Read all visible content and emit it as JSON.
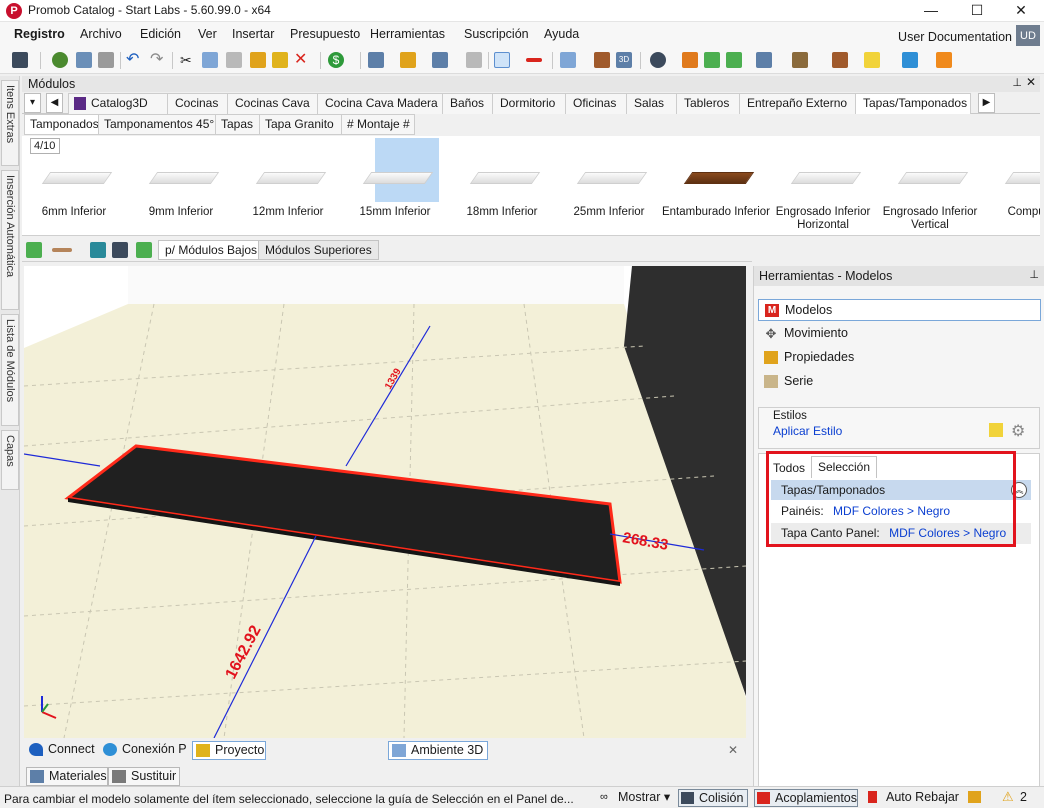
{
  "window": {
    "title": "Promob Catalog - Start Labs - 5.60.99.0 - x64",
    "controls": [
      "—",
      "☐",
      "✕"
    ]
  },
  "menu": {
    "items": [
      "Registro",
      "Archivo",
      "Edición",
      "Ver",
      "Insertar",
      "Presupuesto",
      "Herramientas",
      "Suscripción",
      "Ayuda"
    ],
    "user_documentation": "User Documentation",
    "user_initials": "UD"
  },
  "left_dock": {
    "tabs": [
      "Itens Extras",
      "Inserción Automática",
      "Lista de Módulos",
      "Capas"
    ]
  },
  "modulos": {
    "title": "Módulos",
    "pin": "ᵖ",
    "close": "✕",
    "category_tabs": [
      "Catalog3D",
      "Cocinas",
      "Cocinas Cava",
      "Cocina Cava Madera",
      "Baños",
      "Dormitorio",
      "Oficinas",
      "Salas",
      "Tableros",
      "Entrepaño Externo",
      "Tapas/Tamponados"
    ],
    "active_category": "Tapas/Tamponados",
    "sub_tabs": [
      "Tamponados",
      "Tamponamentos 45°",
      "Tapas",
      "Tapa Granito",
      "# Montaje #"
    ],
    "active_sub_tab": "Tamponados",
    "page_counter": "4/10",
    "items": [
      {
        "label": "6mm Inferior",
        "dark": false
      },
      {
        "label": "9mm Inferior",
        "dark": false
      },
      {
        "label": "12mm Inferior",
        "dark": false
      },
      {
        "label": "15mm Inferior",
        "dark": false,
        "selected": true
      },
      {
        "label": "18mm Inferior",
        "dark": false
      },
      {
        "label": "25mm Inferior",
        "dark": false
      },
      {
        "label": "Entamburado Inferior",
        "dark": true
      },
      {
        "label": "Engrosado Inferior Horizontal",
        "dark": false
      },
      {
        "label": "Engrosado Inferior Vertical",
        "dark": false
      },
      {
        "label": "Compuesto",
        "dark": false
      }
    ]
  },
  "view_tabs": {
    "items": [
      "p/ Módulos Bajos",
      "Módulos Superiores"
    ],
    "active": "p/ Módulos Bajos"
  },
  "viewport": {
    "dimension_top": "1339",
    "dimension_right": "268.33",
    "dimension_bottom": "1642.92"
  },
  "bottom_tabs": {
    "items": [
      "Connect",
      "Conexión P",
      "Proyecto"
    ],
    "active": "Proyecto",
    "view_tab": "Ambiente 3D",
    "close": "✕"
  },
  "lower_tabs": [
    "Materiales",
    "Sustituir"
  ],
  "right_panel": {
    "title": "Herramientas - Modelos",
    "pin": "ᵖ",
    "items": [
      "Modelos",
      "Movimiento",
      "Propiedades",
      "Serie"
    ],
    "active_item": "Modelos",
    "estilos_label": "Estilos",
    "apply_style": "Aplicar Estilo",
    "prop_tabs": [
      "Todos",
      "Selección"
    ],
    "active_prop_tab": "Selección",
    "group": "Tapas/Tamponados",
    "properties": [
      {
        "name": "Painéis:",
        "value": "MDF Colores > Negro"
      },
      {
        "name": "Tapa Canto Panel:",
        "value": "MDF Colores > Negro"
      }
    ]
  },
  "status_bar": {
    "message": "Para cambiar el modelo solamente del ítem seleccionado, seleccione la guía de Selección en el Panel de...",
    "mostrar": "Mostrar",
    "colision": "Colisión",
    "acoplamientos": "Acoplamientos",
    "auto_rebajar": "Auto Rebajar",
    "warnings": "2"
  },
  "colors": {
    "accent_blue": "#0b3fd1",
    "highlight_red": "#e2131d",
    "selection_blue": "#bcd9f5",
    "floor": "#f3f0d8"
  }
}
